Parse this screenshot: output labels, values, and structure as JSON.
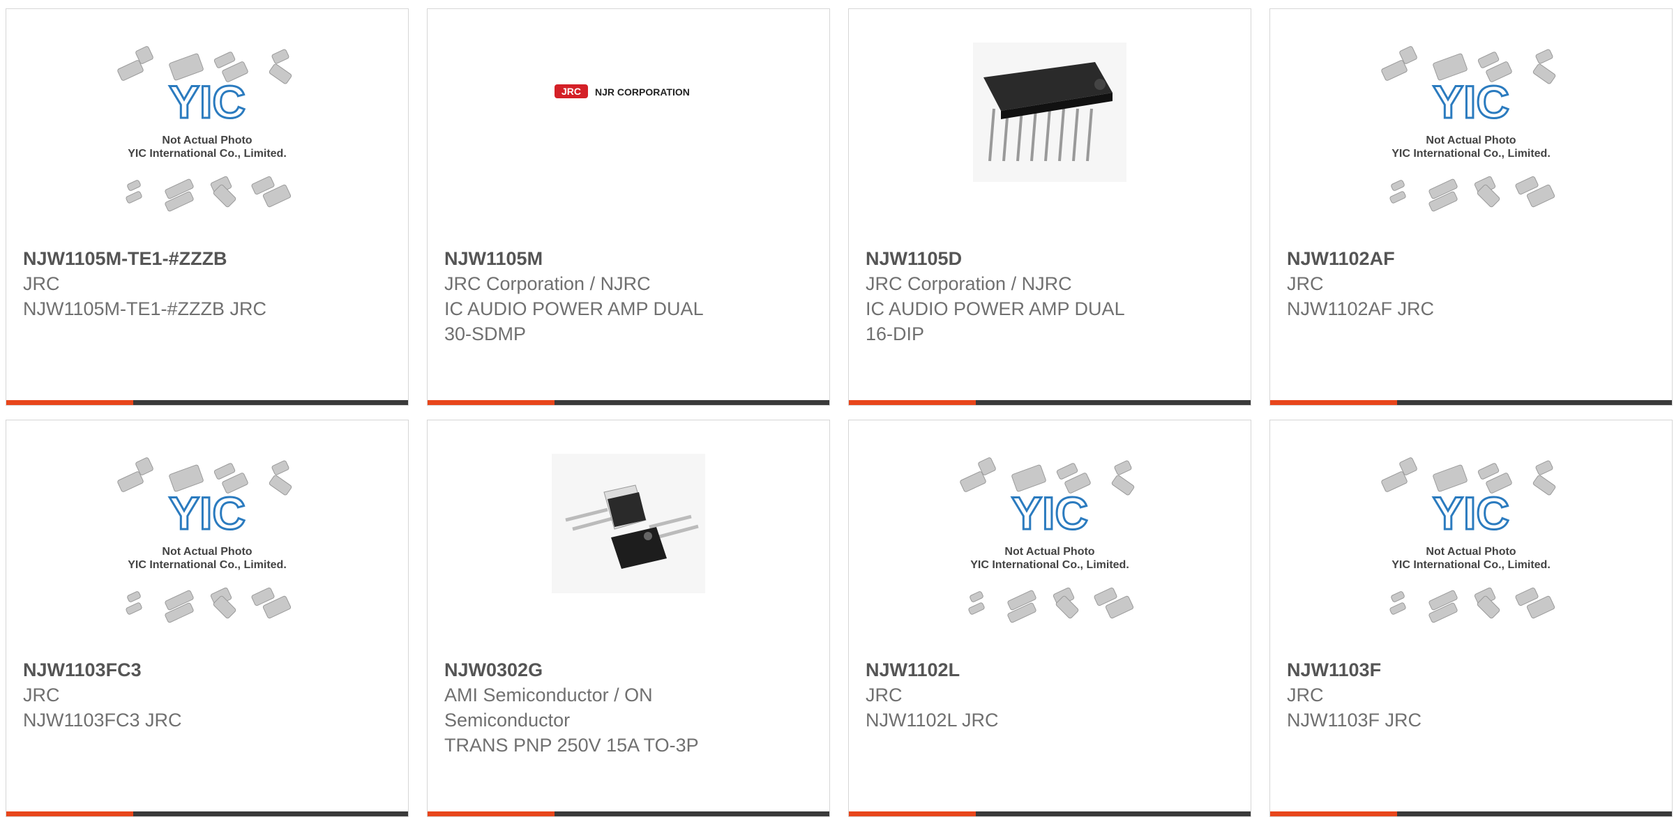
{
  "colors": {
    "accent": "#e8461b",
    "bar": "#3a3a3a",
    "border": "#d6d6d6"
  },
  "placeholder": {
    "line1": "Not Actual Photo",
    "line2": "YIC International Co., Limited."
  },
  "products": [
    {
      "part": "NJW1105M-TE1-#ZZZB",
      "maker": "JRC",
      "desc": "NJW1105M-TE1-#ZZZB JRC",
      "desc2": "",
      "image": "yic-placeholder"
    },
    {
      "part": "NJW1105M",
      "maker": "JRC Corporation / NJRC",
      "desc": "IC AUDIO POWER AMP DUAL",
      "desc2": "30-SDMP",
      "image": "njr-logo",
      "logo_mark": "JRC",
      "logo_text": "NJR CORPORATION"
    },
    {
      "part": "NJW1105D",
      "maker": "JRC Corporation / NJRC",
      "desc": "IC AUDIO POWER AMP DUAL",
      "desc2": "16-DIP",
      "image": "dip-chip"
    },
    {
      "part": "NJW1102AF",
      "maker": "JRC",
      "desc": "NJW1102AF JRC",
      "desc2": "",
      "image": "yic-placeholder"
    },
    {
      "part": "NJW1103FC3",
      "maker": "JRC",
      "desc": "NJW1103FC3 JRC",
      "desc2": "",
      "image": "yic-placeholder"
    },
    {
      "part": "NJW0302G",
      "maker": "AMI Semiconductor / ON",
      "desc": "Semiconductor",
      "desc2": "TRANS PNP 250V 15A TO-3P",
      "image": "to3p-transistor"
    },
    {
      "part": "NJW1102L",
      "maker": "JRC",
      "desc": "NJW1102L JRC",
      "desc2": "",
      "image": "yic-placeholder"
    },
    {
      "part": "NJW1103F",
      "maker": "JRC",
      "desc": "NJW1103F JRC",
      "desc2": "",
      "image": "yic-placeholder"
    }
  ]
}
